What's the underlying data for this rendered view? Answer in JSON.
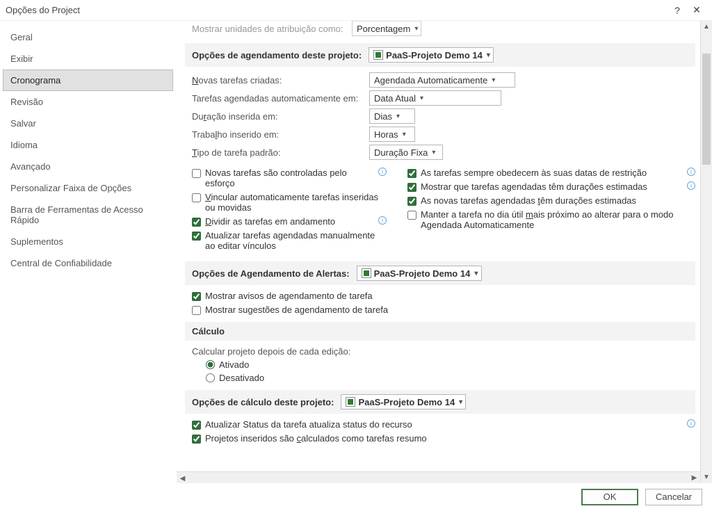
{
  "window": {
    "title": "Opções do Project",
    "help": "?",
    "close": "✕"
  },
  "sidebar": {
    "items": [
      "Geral",
      "Exibir",
      "Cronograma",
      "Revisão",
      "Salvar",
      "Idioma",
      "Avançado",
      "Personalizar Faixa de Opções",
      "Barra de Ferramentas de Acesso Rápido",
      "Suplementos",
      "Central de Confiabilidade"
    ],
    "selected_index": 2
  },
  "truncated": {
    "label": "Mostrar unidades de atribuição como:",
    "value": "Porcentagem"
  },
  "section1": {
    "title": "Opções de agendamento deste projeto:",
    "project": "PaaS-Projeto Demo 14",
    "rows": {
      "novas_tarefas_label": "Novas tarefas criadas:",
      "novas_tarefas_value": "Agendada Automaticamente",
      "tarefas_auto_label": "Tarefas agendadas automaticamente em:",
      "tarefas_auto_value": "Data Atual",
      "duracao_label": "Duração inserida em:",
      "duracao_value": "Dias",
      "trabalho_label": "Trabalho inserido em:",
      "trabalho_value": "Horas",
      "tipo_label": "Tipo de tarefa padrão:",
      "tipo_value": "Duração Fixa"
    },
    "left_checks": {
      "c1": "Novas tarefas são controladas pelo esforço",
      "c2": "Vincular automaticamente tarefas inseridas ou movidas",
      "c3": "Dividir as tarefas em andamento",
      "c4": "Atualizar tarefas agendadas manualmente ao editar vínculos"
    },
    "right_checks": {
      "c1": "As tarefas sempre obedecem às suas datas de restrição",
      "c2": "Mostrar que tarefas agendadas têm durações estimadas",
      "c3": "As novas tarefas agendadas têm durações estimadas",
      "c4": "Manter a tarefa no dia útil mais próximo ao alterar para o modo Agendada Automaticamente"
    }
  },
  "section2": {
    "title": "Opções de Agendamento de Alertas:",
    "project": "PaaS-Projeto Demo 14",
    "c1": "Mostrar avisos de agendamento de tarefa",
    "c2": "Mostrar sugestões de agendamento de tarefa"
  },
  "section3": {
    "title": "Cálculo",
    "sub": "Calcular projeto depois de cada edição:",
    "r1": "Ativado",
    "r2": "Desativado"
  },
  "section4": {
    "title": "Opções de cálculo deste projeto:",
    "project": "PaaS-Projeto Demo 14",
    "c1": "Atualizar Status da tarefa atualiza status do recurso",
    "c2": "Projetos inseridos são calculados como tarefas resumo"
  },
  "buttons": {
    "ok": "OK",
    "cancel": "Cancelar"
  }
}
